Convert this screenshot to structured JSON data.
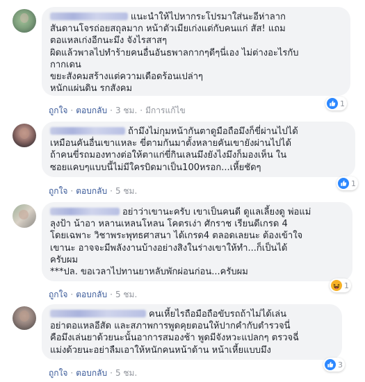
{
  "comments": [
    {
      "lines": [
        "แนะนำให้ไปหากระโปรมาใส่นะอีห่าลาก",
        "สันดานโจรถ่อยสถุลมาก หน้าตัวเมียเก่งแต่กับคนแก่ สัส! แถม",
        "ตอแหลเก่งอีกนะมึง จังไรสาสๆ",
        "ผิดแล้วพาลไปทำร้ายคนอื่นอันธพาลกากๆดีๆนี่เอง ไม่ต่างอะไรกับ",
        "กากเดน",
        "ขยะสังคมสร้างแต่ความเดือดร้อนเปล่าๆ",
        "หนักแผ่นดิน รกสังคม"
      ],
      "actions": {
        "like": "ถูกใจ",
        "reply": "ตอบกลับ",
        "time": "3 ชม.",
        "edited": "มีการแก้ไข"
      },
      "reaction": {
        "icon": "like-icon",
        "count": "1"
      }
    },
    {
      "lines": [
        "ถ้ามึงไม่กุมหน้ากันตาดูมือถือมึงก็ขี่ผ่านไปได้",
        "เหมือนคันอื่นเขาแหละ ขี่ตามกันมาตั้งหลายคันเขายังผ่านไปได้",
        "ถ้าคนขี่รถมองทางต่อให้ตาแก่ขี่กินเลนมึงยังไงมึงก็มองเห็น ใน",
        "ซอยแคบๆแบบนี้ไม่มีใครบิดมาเป็น100หรอก...เหี้ยชัดๆ"
      ],
      "actions": {
        "like": "ถูกใจ",
        "reply": "ตอบกลับ",
        "time": "5 ชม."
      },
      "reaction": {
        "icon": "like-icon",
        "count": "1"
      }
    },
    {
      "lines": [
        "อย่าว่าเขานะครับ เขาเป็นคนดี ดูแลเลี้ยงดู พ่อแม่",
        "ลุงป้า น้าอา หลานเหลนโหลน โคตรเง่า ศักราช เรียนดีเกรด 4",
        "โดยเฉพาะ วิชาพระพุทธศาสนา ได้เกรด4 ตลอดเลยนะ ต้องเข้าใจ",
        "เขานะ อาจจะมีพลังงานบ้างอย่างสิงในร่างเขาให้ทำ...ก็เป็นได้",
        "ครับผม",
        "***ปล. ขอเวลาไปทานยาหลับพักผ่อนก่อน...ครับผม"
      ],
      "actions": {
        "like": "ถูกใจ",
        "reply": "ตอบกลับ",
        "time": "5 ชม."
      },
      "reaction": {
        "icon": "haha-icon",
        "count": "1"
      }
    },
    {
      "lines": [
        "คนเหี้ยไรถือมือถือขับรถถ้าไม่ได้เล่น",
        "อย่าตอแหลอีสัด และสภาพการพูดคุยตอนให้ปากคำกับตำรวจนี่",
        "คือมึงเล่นยาด้วยนะนั้นอาการสมองช้า พูดมีจังหวะแปลกๆ ตรวจฉี่",
        "แม่งด้วยนะอย่าลืมเอาให้หนักคนหน้าด้าน หน้าเหี้ยแบบมึง"
      ],
      "actions": {
        "like": "ถูกใจ",
        "reply": "ตอบกลับ",
        "time": "5 ชม."
      },
      "reaction": {
        "icon": "like-icon",
        "count": "3"
      }
    }
  ],
  "colors": {
    "bubble": "#f2f3f5",
    "text": "#1d2129",
    "link": "#385898",
    "meta": "#90949c",
    "like": "#2d88ff",
    "haha": "#f7b125"
  }
}
